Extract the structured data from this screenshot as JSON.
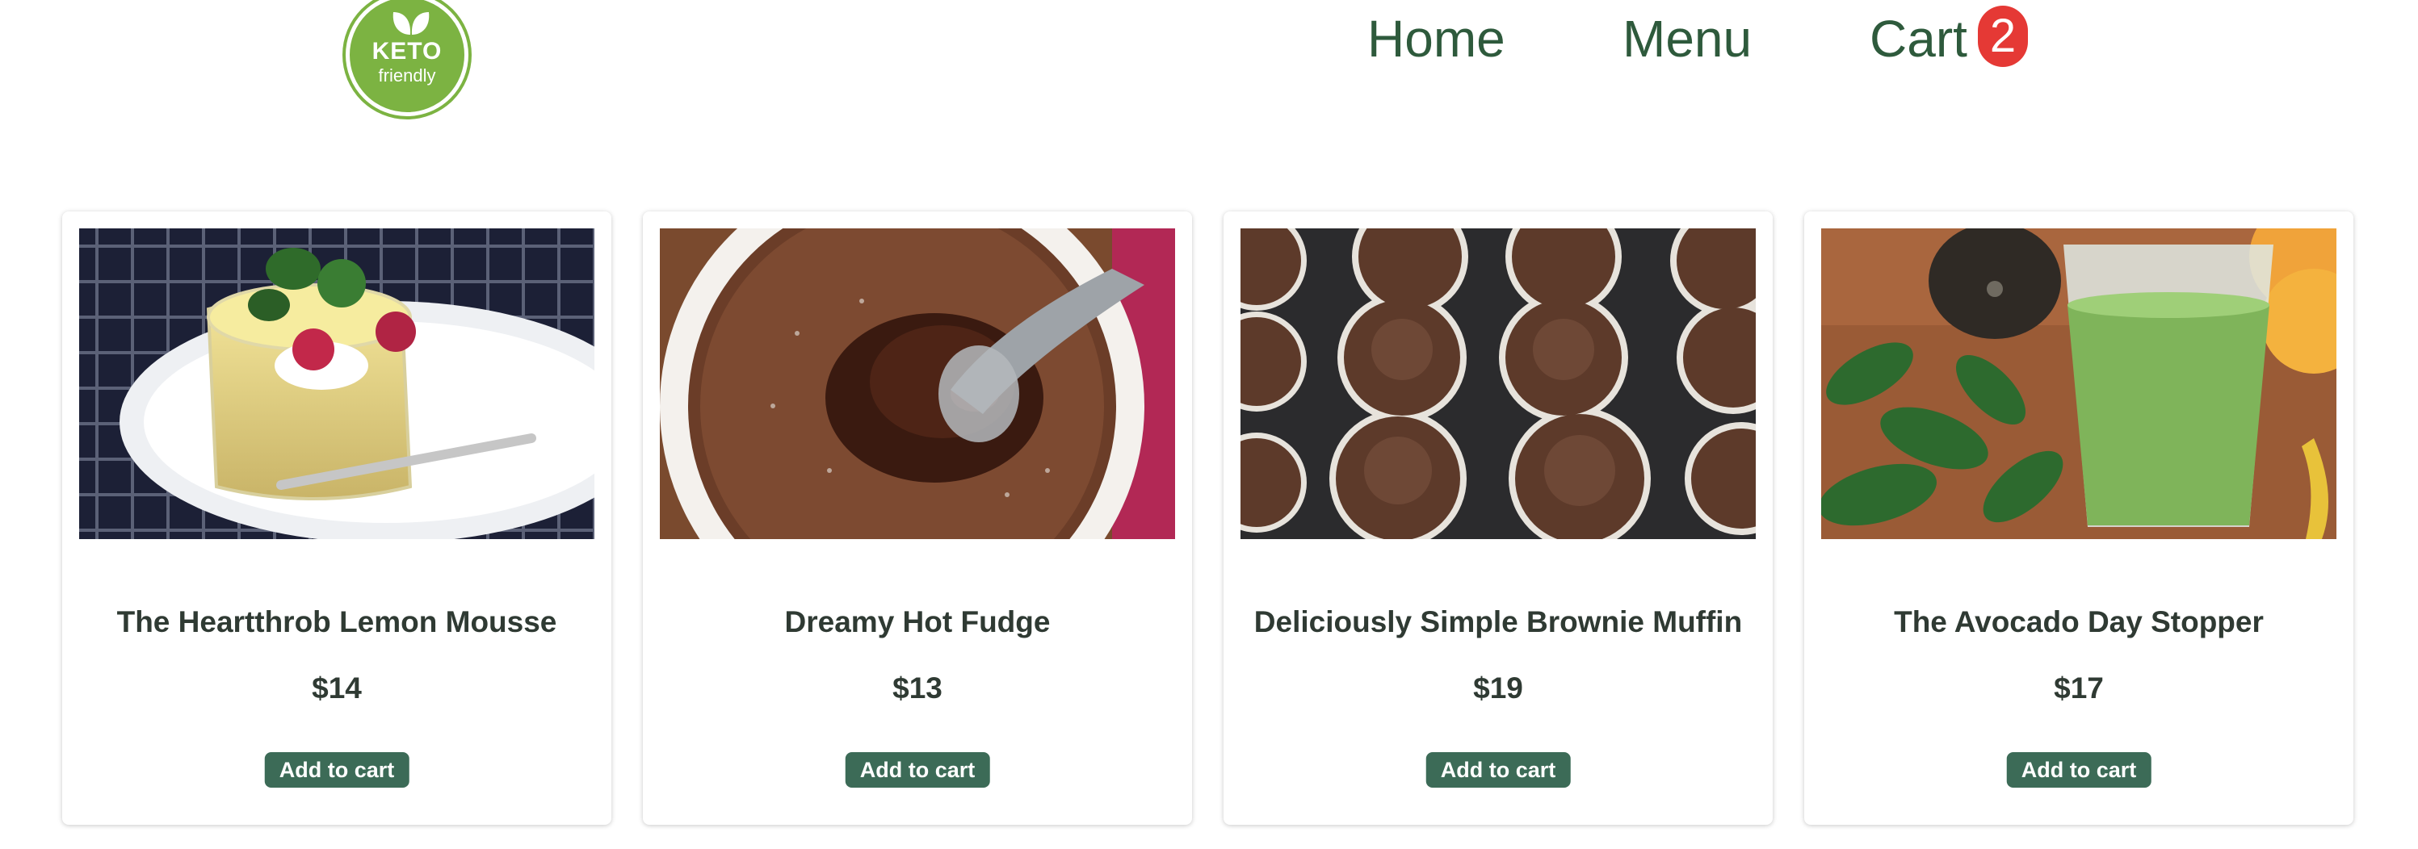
{
  "logo": {
    "line1": "KETO",
    "line2": "friendly"
  },
  "nav": {
    "home": "Home",
    "menu": "Menu",
    "cart": "Cart",
    "cart_count": "2"
  },
  "products": [
    {
      "name": "The Heartthrob Lemon Mousse",
      "price": "$14",
      "button": "Add to cart"
    },
    {
      "name": "Dreamy Hot Fudge",
      "price": "$13",
      "button": "Add to cart"
    },
    {
      "name": "Deliciously Simple Brownie Muffin",
      "price": "$19",
      "button": "Add to cart"
    },
    {
      "name": "The Avocado Day Stopper",
      "price": "$17",
      "button": "Add to cart"
    }
  ],
  "colors": {
    "brand_green": "#7cb342",
    "nav_text": "#2e5a3c",
    "badge_red": "#e53935",
    "button_green": "#3c6b57"
  }
}
